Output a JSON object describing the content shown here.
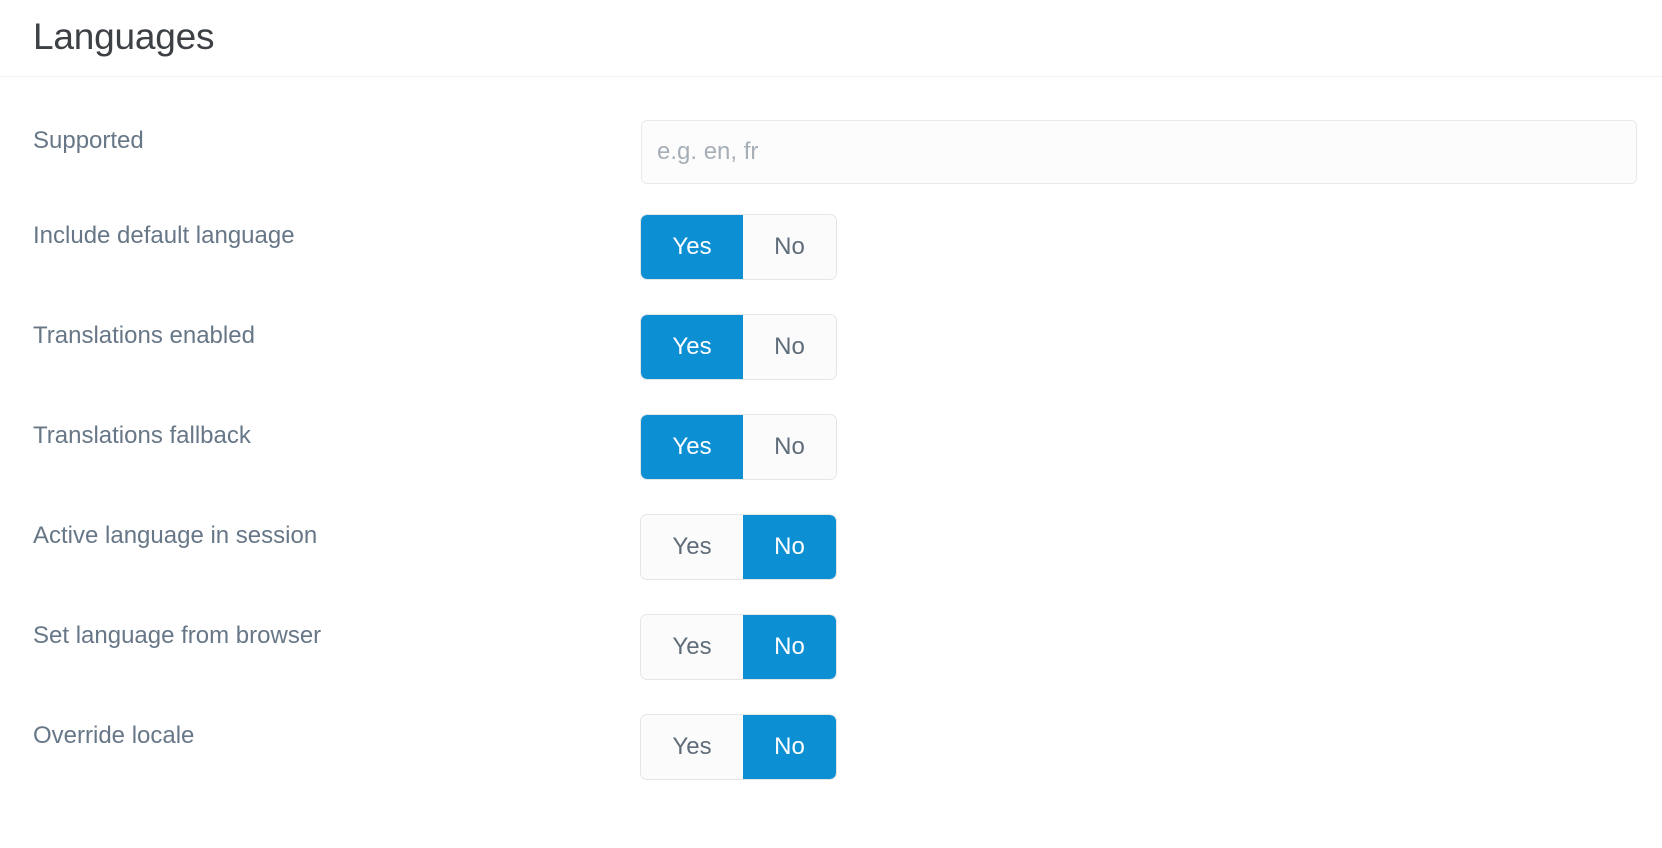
{
  "header": {
    "title": "Languages"
  },
  "toggle": {
    "yes_label": "Yes",
    "no_label": "No"
  },
  "colors": {
    "accent": "#0d8fd4",
    "title_text": "#3d4145",
    "label_text": "#677787",
    "inactive_text": "#5f6c7a",
    "input_border": "#e7e9ea",
    "input_background": "#fcfcfc",
    "placeholder_text": "#a6aeb7",
    "divider": "#f1f2f3",
    "page_background": "#ffffff"
  },
  "rows": [
    {
      "label": "Supported",
      "type": "text",
      "value": "",
      "placeholder": "e.g. en, fr"
    },
    {
      "label": "Include default language",
      "type": "toggle",
      "value": "Yes"
    },
    {
      "label": "Translations enabled",
      "type": "toggle",
      "value": "Yes"
    },
    {
      "label": "Translations fallback",
      "type": "toggle",
      "value": "Yes"
    },
    {
      "label": "Active language in session",
      "type": "toggle",
      "value": "No"
    },
    {
      "label": "Set language from browser",
      "type": "toggle",
      "value": "No"
    },
    {
      "label": "Override locale",
      "type": "toggle",
      "value": "No"
    }
  ]
}
